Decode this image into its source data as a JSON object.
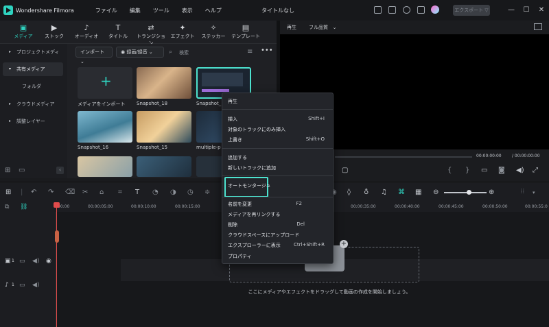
{
  "titlebar": {
    "app_name": "Wondershare Filmora",
    "menu": [
      "ファイル",
      "編集",
      "ツール",
      "表示",
      "ヘルプ"
    ],
    "window_title": "タイトルなし",
    "export_label": "エクスポート ▽"
  },
  "tabs": [
    {
      "label": "メディア",
      "icon": "media-icon"
    },
    {
      "label": "ストック",
      "icon": "stock-icon"
    },
    {
      "label": "オーディオ",
      "icon": "music-icon"
    },
    {
      "label": "タイトル",
      "icon": "title-icon"
    },
    {
      "label": "トランジション",
      "icon": "transition-icon"
    },
    {
      "label": "エフェクト",
      "icon": "effect-icon"
    },
    {
      "label": "ステッカー",
      "icon": "sticker-icon"
    },
    {
      "label": "テンプレート",
      "icon": "template-icon"
    }
  ],
  "sidebar": {
    "items": [
      "プロジェクトメディア",
      "共有メディア",
      "フォルダ",
      "クラウドメディア",
      "調整レイヤー"
    ]
  },
  "media_toolbar": {
    "import": "インポート",
    "record": "録画/録音",
    "search_placeholder": "検索"
  },
  "media": [
    {
      "label": "メディアをインポート"
    },
    {
      "label": "Snapshot_18"
    },
    {
      "label": "Snapshot_"
    },
    {
      "label": "Snapshot_16"
    },
    {
      "label": "Snapshot_15"
    },
    {
      "label": "multiple-p"
    }
  ],
  "preview": {
    "label": "再生",
    "quality": "フル品質",
    "time_current": "00:00:00:00",
    "time_total": "/ 00:00:00:00"
  },
  "ruler": [
    "00:00",
    "00:00:05:00",
    "00:00:10:00",
    "00:00:15:00",
    "00:00:35:00",
    "00:00:40:00",
    "00:00:45:00",
    "00:00:50:00",
    "00:00:55:0"
  ],
  "timeline_hint": "ここにメディアやエフェクトをドラッグして動画の作成を開始しましょう。",
  "tracks": {
    "video": "1",
    "audio": "1"
  },
  "context_menu": {
    "play": "再生",
    "insert": "挿入",
    "insert_shortcut": "Shift+I",
    "insert_selected": "対象のトラックにのみ挿入",
    "overwrite": "上書き",
    "overwrite_shortcut": "Shift+O",
    "append": "追加する",
    "add_new_track": "新しいトラックに追加",
    "auto_montage": "オートモンタージュ",
    "rename": "名前を変更",
    "rename_shortcut": "F2",
    "relink": "メディアを再リンクする",
    "delete": "削除",
    "delete_shortcut": "Del",
    "upload_cloud": "クラウドスペースにアップロード",
    "reveal": "エクスプローラーに表示",
    "reveal_shortcut": "Ctrl+Shift+R",
    "properties": "プロパティ"
  }
}
